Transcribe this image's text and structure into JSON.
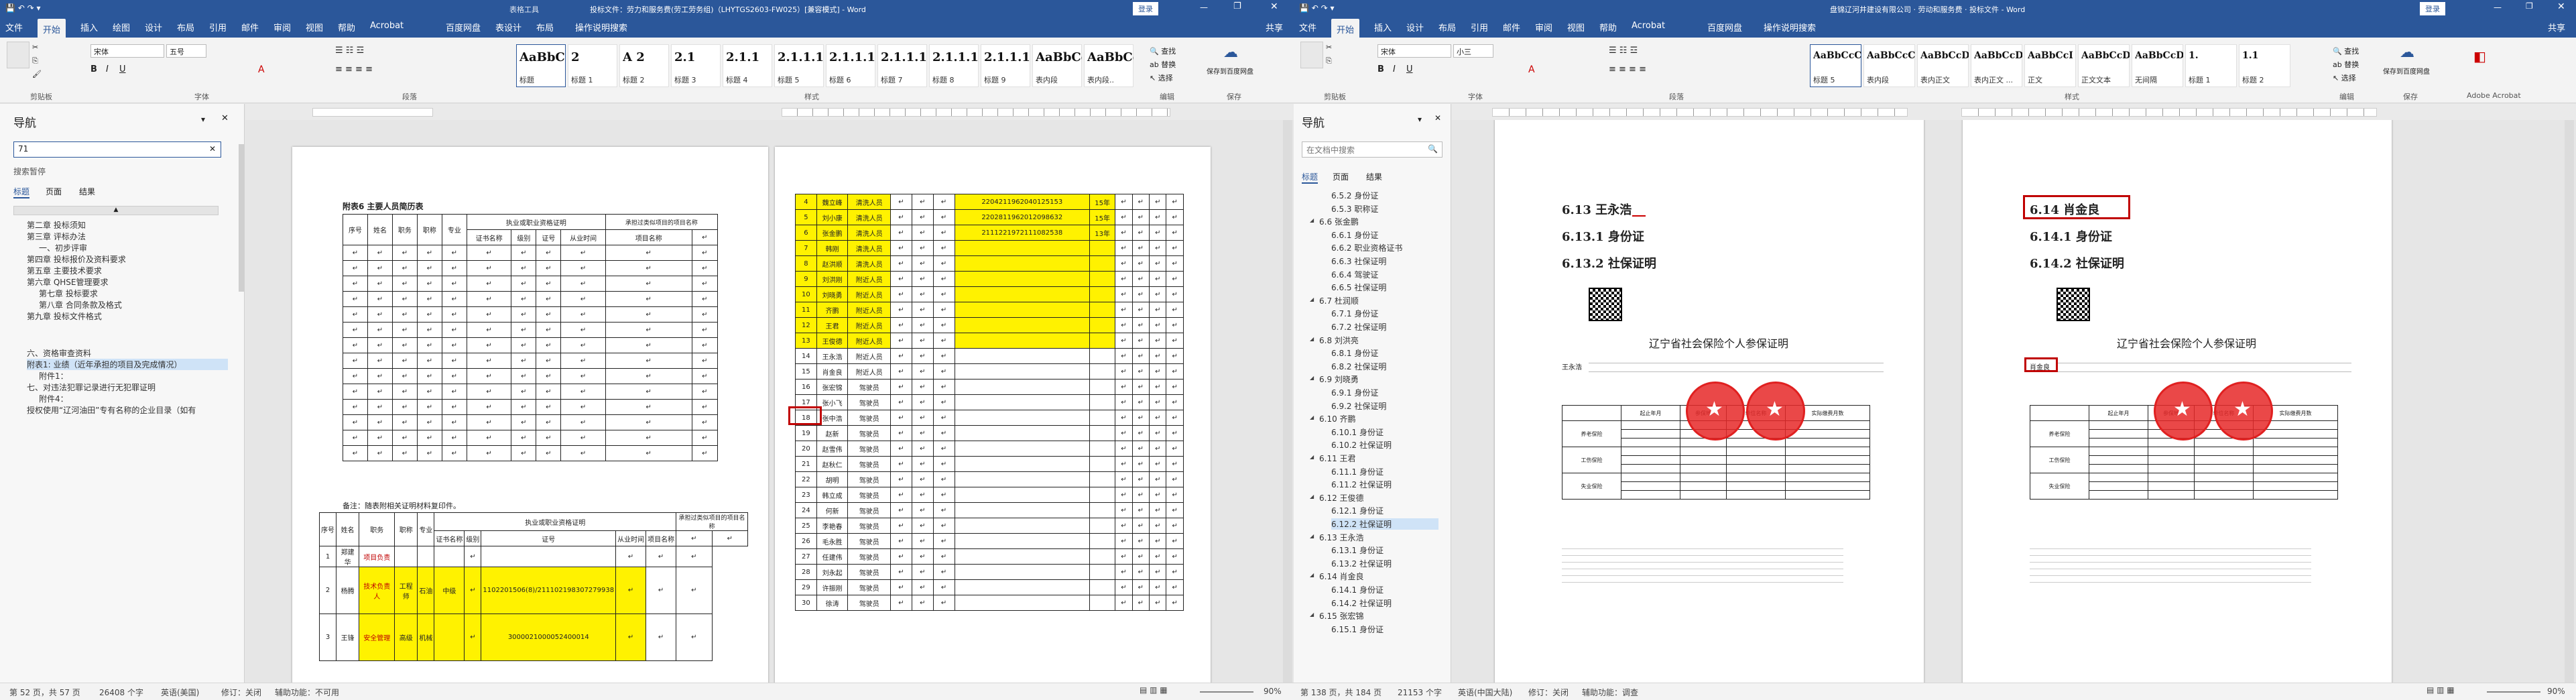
{
  "left": {
    "title": "投标文件：劳力和服务费(劳工劳务组)（LHYTGS2603-FW025）[兼容模式] - Word",
    "context_tab": "表格工具",
    "account": "登录",
    "share": "共享",
    "tabs": [
      "文件",
      "开始",
      "插入",
      "绘图",
      "设计",
      "布局",
      "引用",
      "邮件",
      "审阅",
      "视图",
      "帮助",
      "Acrobat",
      "百度网盘",
      "表设计",
      "布局"
    ],
    "tell_me": "操作说明搜索",
    "font_name": "宋体",
    "font_size": "五号",
    "styles": [
      {
        "sample": "AaBbC",
        "name": "标题"
      },
      {
        "sample": "2",
        "name": "标题 1"
      },
      {
        "sample": "A 2",
        "name": "标题 2"
      },
      {
        "sample": "2.1",
        "name": "标题 3"
      },
      {
        "sample": "2.1.1",
        "name": "标题 4"
      },
      {
        "sample": "2.1.1.1",
        "name": "标题 5"
      },
      {
        "sample": "2.1.1.1.",
        "name": "标题 6"
      },
      {
        "sample": "2.1.1.1.1",
        "name": "标题 7"
      },
      {
        "sample": "2.1.1.1.1",
        "name": "标题 8"
      },
      {
        "sample": "2.1.1.1.1",
        "name": "标题 9"
      },
      {
        "sample": "AaBbCc",
        "name": "表内段"
      },
      {
        "sample": "AaBbCc",
        "name": "表内段.."
      }
    ],
    "group_labels": [
      "剪贴板",
      "字体",
      "段落",
      "样式",
      "编辑",
      "保存",
      "Adobe Acrobat"
    ],
    "find": "查找",
    "replace": "替换",
    "select": "选择",
    "save_baidu": "保存到百度网盘",
    "nav_title": "导航",
    "search_value": "71",
    "search_results": "搜索暂停",
    "nav_tabs": [
      "标题",
      "页面",
      "结果"
    ],
    "nav_items": [
      "第二章 投标须知",
      "第三章 评标办法",
      "一、初步评审",
      "第四章 投标报价及资料要求",
      "第五章 主要技术要求",
      "第六章 QHSE管理要求",
      "第七章 投标要求",
      "第八章 合同条款及格式",
      "第九章 投标文件格式",
      "六、资格审查资料",
      "附表1: 业绩（近年承担的项目及完成情况）",
      "附件1：",
      "七、对违法犯罪记录进行无犯罪证明",
      "附件4：",
      "授权使用“辽河油田”专有名称的企业目录（如有"
    ],
    "table1_title": "附表6 主要人员简历表",
    "table1_note": "备注：随表附相关证明材料复印件。",
    "page_header": [
      "序号",
      "姓名",
      "职务",
      "职称",
      "专业",
      "执业或职业资格证明",
      "承担过类似项目的项目名称",
      "证书名称",
      "级别",
      "证号",
      "从业时间",
      "项目名称"
    ],
    "row_data": [
      {
        "no": "1",
        "name": "郑建华",
        "role": "项目负责",
        "title": "",
        "major": "",
        "cert": "",
        "id": ""
      },
      {
        "no": "2",
        "name": "杨腾",
        "role": "技术负责人",
        "title": "工程师",
        "major": "石油",
        "cert": "中级",
        "id": "1102201506(8)/211102198307279938"
      },
      {
        "no": "3",
        "name": "王锋",
        "role": "安全管理",
        "title": "高级",
        "major": "机械",
        "cert": "",
        "id": "3000021000052400014"
      }
    ],
    "t2": [
      {
        "no": "4",
        "name": "魏立峰",
        "role": "清洗人员",
        "id": "2204211962040125153",
        "yrs": "15年"
      },
      {
        "no": "5",
        "name": "刘小康",
        "role": "清洗人员",
        "id": "2202811962012098632",
        "yrs": "15年"
      },
      {
        "no": "6",
        "name": "张金鹏",
        "role": "清洗人员",
        "id": "2111221972111082538",
        "yrs": "13年"
      },
      {
        "no": "7",
        "name": "韩刚",
        "role": "清洗人员",
        "id": "",
        "yrs": ""
      },
      {
        "no": "8",
        "name": "赵洪顺",
        "role": "清洗人员",
        "id": "",
        "yrs": ""
      },
      {
        "no": "9",
        "name": "刘洪刚",
        "role": "附近人员",
        "id": "",
        "yrs": ""
      },
      {
        "no": "10",
        "name": "刘晓勇",
        "role": "附近人员",
        "id": "",
        "yrs": ""
      },
      {
        "no": "11",
        "name": "齐鹏",
        "role": "附近人员",
        "id": "",
        "yrs": ""
      },
      {
        "no": "12",
        "name": "王君",
        "role": "附近人员",
        "id": "",
        "yrs": ""
      },
      {
        "no": "13",
        "name": "王俊德",
        "role": "附近人员",
        "id": "",
        "yrs": ""
      },
      {
        "no": "14",
        "name": "王永浩",
        "role": "附近人员",
        "id": "",
        "yrs": ""
      },
      {
        "no": "15",
        "name": "肖金良",
        "role": "附近人员",
        "id": "",
        "yrs": ""
      },
      {
        "no": "16",
        "name": "张宏锦",
        "role": "驾驶员",
        "id": "",
        "yrs": ""
      },
      {
        "no": "17",
        "name": "张小飞",
        "role": "驾驶员",
        "id": "",
        "yrs": ""
      },
      {
        "no": "18",
        "name": "张中浩",
        "role": "驾驶员",
        "id": "",
        "yrs": ""
      },
      {
        "no": "19",
        "name": "赵新",
        "role": "驾驶员",
        "id": "",
        "yrs": ""
      },
      {
        "no": "20",
        "name": "赵雪伟",
        "role": "驾驶员",
        "id": "",
        "yrs": ""
      },
      {
        "no": "21",
        "name": "赵秋仁",
        "role": "驾驶员",
        "id": "",
        "yrs": ""
      },
      {
        "no": "22",
        "name": "胡明",
        "role": "驾驶员",
        "id": "",
        "yrs": ""
      },
      {
        "no": "23",
        "name": "韩立成",
        "role": "驾驶员",
        "id": "",
        "yrs": ""
      },
      {
        "no": "24",
        "name": "何新",
        "role": "驾驶员",
        "id": "",
        "yrs": ""
      },
      {
        "no": "25",
        "name": "李艳春",
        "role": "驾驶员",
        "id": "",
        "yrs": ""
      },
      {
        "no": "26",
        "name": "毛永胜",
        "role": "驾驶员",
        "id": "",
        "yrs": ""
      },
      {
        "no": "27",
        "name": "任建伟",
        "role": "驾驶员",
        "id": "",
        "yrs": ""
      },
      {
        "no": "28",
        "name": "刘永起",
        "role": "驾驶员",
        "id": "",
        "yrs": ""
      },
      {
        "no": "29",
        "name": "许振刚",
        "role": "驾驶员",
        "id": "",
        "yrs": ""
      },
      {
        "no": "30",
        "name": "徐涛",
        "role": "驾驶员",
        "id": "",
        "yrs": ""
      }
    ],
    "status_page": "第 52 页，共 57 页",
    "status_words": "26408 个字",
    "status_lang": "英语(美国)",
    "status_track": "修订：关闭",
    "status_access": "辅助功能：不可用",
    "zoom": "90%"
  },
  "right": {
    "title": "盘锦辽河井建设有限公司 · 劳动和服务费 · 投标文件 - Word",
    "account": "登录",
    "share": "共享",
    "tabs": [
      "文件",
      "开始",
      "插入",
      "设计",
      "布局",
      "引用",
      "邮件",
      "审阅",
      "视图",
      "帮助",
      "Acrobat",
      "百度网盘"
    ],
    "tell_me": "操作说明搜索",
    "font_name": "宋体",
    "font_size": "小三",
    "styles": [
      {
        "sample": "AaBbCcC",
        "name": "标题 5"
      },
      {
        "sample": "AaBbCcC",
        "name": "表内段"
      },
      {
        "sample": "AaBbCcD",
        "name": "表内正文"
      },
      {
        "sample": "AaBbCcD",
        "name": "表内正文 ..."
      },
      {
        "sample": "AaBbCcI",
        "name": "正文"
      },
      {
        "sample": "AaBbCcDd",
        "name": "正文文本"
      },
      {
        "sample": "AaBbCcDd",
        "name": "无间隔"
      },
      {
        "sample": "1.",
        "name": "标题 1"
      },
      {
        "sample": "1.1",
        "name": "标题 2"
      }
    ],
    "group_labels": [
      "剪贴板",
      "字体",
      "段落",
      "样式",
      "编辑",
      "保存",
      "Adobe Acrobat"
    ],
    "find": "查找",
    "replace": "替换",
    "select": "选择",
    "save_baidu": "保存到百度网盘",
    "nav_title": "导航",
    "search_placeholder": "在文档中搜索",
    "nav_tabs": [
      "标题",
      "页面",
      "结果"
    ],
    "nav_items": [
      "6.5.2 身份证",
      "6.5.3 职称证",
      "6.6 张金鹏",
      "6.6.1 身份证",
      "6.6.2 职业资格证书",
      "6.6.3 社保证明",
      "6.6.4 驾驶证",
      "6.6.5 社保证明",
      "6.7 杜润顺",
      "6.7.1 身份证",
      "6.7.2 社保证明",
      "6.8 刘洪亮",
      "6.8.1 身份证",
      "6.8.2 社保证明",
      "6.9 刘晓勇",
      "6.9.1 身份证",
      "6.9.2 社保证明",
      "6.10 齐鹏",
      "6.10.1 身份证",
      "6.10.2 社保证明",
      "6.11 王君",
      "6.11.1 身份证",
      "6.11.2 社保证明",
      "6.12 王俊德",
      "6.12.1 身份证",
      "6.12.2 社保证明",
      "6.13 王永浩",
      "6.13.1 身份证",
      "6.13.2 社保证明",
      "6.14 肖金良",
      "6.14.1 身份证",
      "6.14.2 社保证明",
      "6.15 张宏锦",
      "6.15.1 身份证"
    ],
    "p1": {
      "h1": "6.13  王永浩",
      "h2": "6.13.1   身份证",
      "h3": "6.13.2   社保证明",
      "cert_title": "辽宁省社会保险个人参保证明",
      "person": "王永浩"
    },
    "p2": {
      "h1": "6.14  肖金良",
      "h2": "6.14.1   身份证",
      "h3": "6.14.2   社保证明",
      "cert_title": "辽宁省社会保险个人参保证明",
      "person": "肖金良"
    },
    "cert_table_head": [
      "起止年月",
      "参保地",
      "单位名称",
      "实际缴费月数"
    ],
    "cert_rows": [
      "养老保险",
      "工伤保险",
      "失业保险"
    ],
    "status_page": "第 138 页，共 184 页",
    "status_words": "21153 个字",
    "status_lang": "英语(中国大陆)",
    "status_track": "修订：关闭",
    "status_access": "辅助功能：调查",
    "zoom": "90%"
  }
}
